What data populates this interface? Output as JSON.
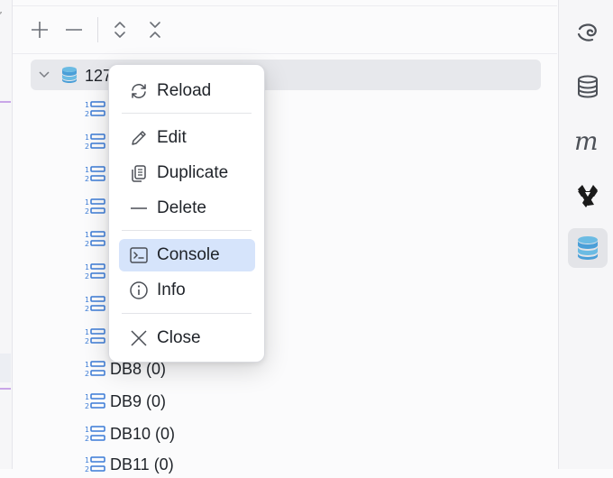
{
  "toolbar": {
    "buttons": [
      {
        "name": "add",
        "icon": "plus-icon"
      },
      {
        "name": "collapse",
        "icon": "minus-icon"
      },
      {
        "name": "expand-all",
        "icon": "expand-vertical-icon"
      },
      {
        "name": "collapse-all",
        "icon": "collapse-vertical-icon"
      }
    ]
  },
  "tree": {
    "root": {
      "label": "127",
      "icon": "database-stack-icon"
    },
    "rows": [
      {
        "label": ""
      },
      {
        "label": ""
      },
      {
        "label": ""
      },
      {
        "label": ""
      },
      {
        "label": ""
      },
      {
        "label": ""
      },
      {
        "label": ""
      },
      {
        "label": ""
      },
      {
        "label": "DB8 (0)"
      },
      {
        "label": "DB9 (0)"
      },
      {
        "label": "DB10 (0)"
      },
      {
        "label": "DB11 (0)"
      }
    ]
  },
  "context_menu": {
    "items": {
      "reload": "Reload",
      "edit": "Edit",
      "duplicate": "Duplicate",
      "delete": "Delete",
      "console": "Console",
      "info": "Info",
      "close": "Close"
    },
    "highlighted": "console"
  },
  "rightbar": {
    "items": [
      "swirl-logo-icon",
      "database-icon",
      "m-logo-icon",
      "star-logo-icon",
      "database-active-icon"
    ],
    "active_index": 4
  },
  "colors": {
    "accent": "#4a9fd8",
    "highlight": "#d6e4fb",
    "list_icon": "#3b7bd6"
  }
}
